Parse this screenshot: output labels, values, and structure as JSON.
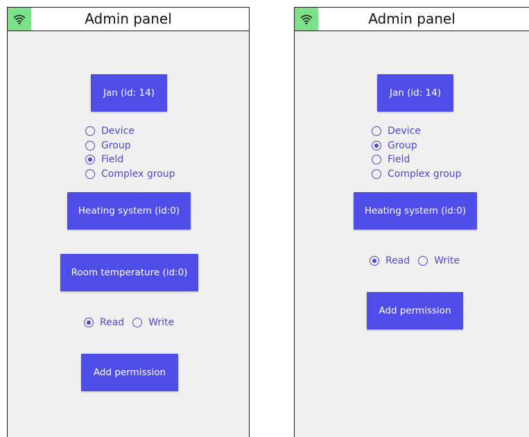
{
  "left_screen": {
    "appbar": {
      "title": "Admin panel",
      "status_icon": "wifi-icon",
      "status_color": "#7be28a"
    },
    "user_button": "Jan (id: 14)",
    "target_type_options": [
      {
        "label": "Device",
        "checked": false
      },
      {
        "label": "Group",
        "checked": false
      },
      {
        "label": "Field",
        "checked": true
      },
      {
        "label": "Complex group",
        "checked": false
      }
    ],
    "group_button": "Heating system (id:0)",
    "field_button": "Room temperature (id:0)",
    "access_options": [
      {
        "label": "Read",
        "checked": true
      },
      {
        "label": "Write",
        "checked": false
      }
    ],
    "add_button": "Add permission"
  },
  "right_screen": {
    "appbar": {
      "title": "Admin panel",
      "status_icon": "wifi-icon",
      "status_color": "#7be28a"
    },
    "user_button": "Jan (id: 14)",
    "target_type_options": [
      {
        "label": "Device",
        "checked": false
      },
      {
        "label": "Group",
        "checked": true
      },
      {
        "label": "Field",
        "checked": false
      },
      {
        "label": "Complex group",
        "checked": false
      }
    ],
    "group_button": "Heating system (id:0)",
    "access_options": [
      {
        "label": "Read",
        "checked": true
      },
      {
        "label": "Write",
        "checked": false
      }
    ],
    "add_button": "Add permission"
  },
  "theme": {
    "accent": "#4f4de8",
    "background": "#f0f0f0",
    "appbar_bg": "#ffffff"
  }
}
